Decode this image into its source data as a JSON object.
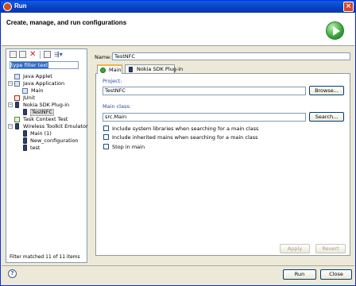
{
  "window": {
    "title": "Run",
    "close_glyph": "×"
  },
  "banner": {
    "heading": "Create, manage, and run configurations"
  },
  "left": {
    "filter_placeholder": "type filter text",
    "tree": [
      {
        "label": "Java Applet",
        "icon": "java-applet-icon"
      },
      {
        "label": "Java Application",
        "icon": "java-application-icon",
        "expander": "−"
      },
      {
        "label": "Main",
        "icon": "java-main-icon"
      },
      {
        "label": "JUnit",
        "icon": "junit-icon"
      },
      {
        "label": "Nokia SDK Plug-in",
        "icon": "nokia-sdk-icon",
        "expander": "−"
      },
      {
        "label": "TestNFC",
        "icon": "device-icon",
        "selected": true
      },
      {
        "label": "Task Context Test",
        "icon": "task-context-icon"
      },
      {
        "label": "Wireless Toolkit Emulator",
        "icon": "wireless-toolkit-icon",
        "expander": "−"
      },
      {
        "label": "Main (1)",
        "icon": "device-icon"
      },
      {
        "label": "New_configuration",
        "icon": "device-icon"
      },
      {
        "label": "test",
        "icon": "device-icon"
      }
    ],
    "status": "Filter matched 11 of 11 items"
  },
  "config": {
    "name_label": "Name:",
    "name_value": "TestNFC",
    "tabs": [
      {
        "label": "Main",
        "active": true
      },
      {
        "label": "Nokia SDK Plug-in",
        "active": false
      }
    ],
    "project_label": "Project:",
    "project_value": "TestNFC",
    "browse_label": "Browse...",
    "main_class_label": "Main class:",
    "main_class_value": "src.Main",
    "search_label": "Search...",
    "checkboxes": [
      {
        "label": "Include system libraries when searching for a main class",
        "checked": false
      },
      {
        "label": "Include inherited mains when searching for a main class",
        "checked": false
      },
      {
        "label": "Stop in main",
        "checked": false
      }
    ],
    "apply_label": "Apply",
    "revert_label": "Revert"
  },
  "footer": {
    "help_glyph": "?",
    "run_label": "Run",
    "close_label": "Close"
  }
}
